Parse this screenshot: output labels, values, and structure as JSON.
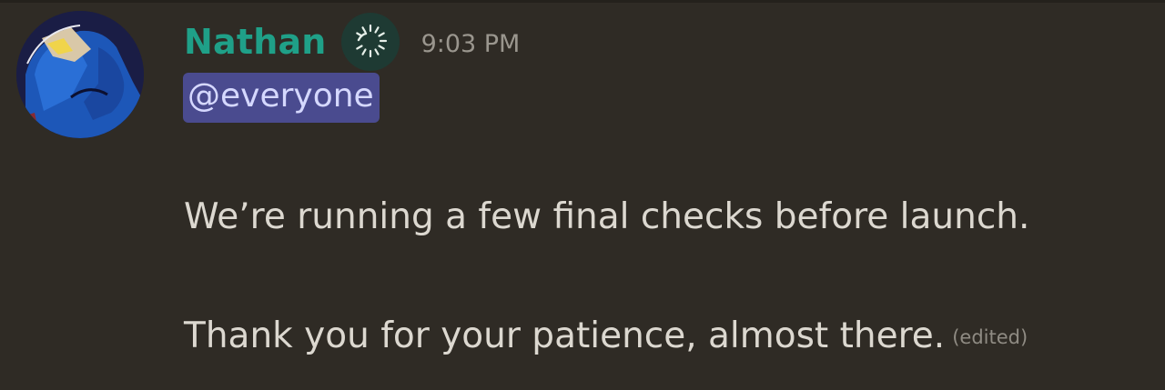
{
  "message": {
    "author": {
      "name": "Nathan",
      "name_color": "#1fa088",
      "avatar_icon": "user-avatar-image",
      "role_icon": "server-tag-badge-icon"
    },
    "timestamp": "9:03 PM",
    "mention": "@everyone",
    "content_lines": [
      "We’re running a few final checks before launch.",
      "Thank you for your patience, almost there."
    ],
    "edited_label": "(edited)"
  },
  "colors": {
    "background": "#2f2b25",
    "mention_bg": "#4a4b8f",
    "mention_text": "#d5d8ff",
    "text": "#dcd8d0",
    "muted": "#9a968e"
  }
}
